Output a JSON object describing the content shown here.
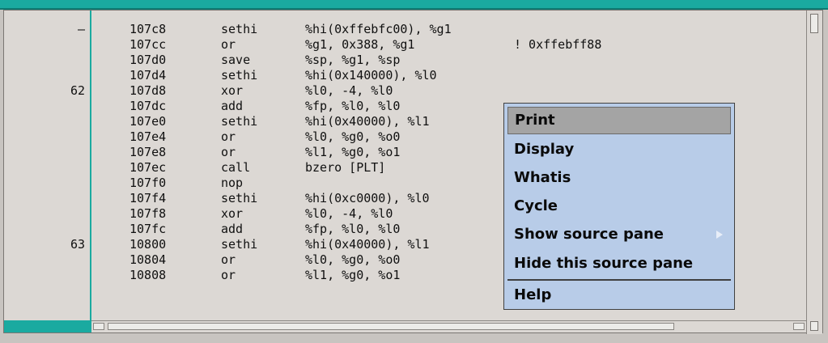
{
  "gutter": {
    "lines": [
      {
        "row": 0,
        "text": "–"
      },
      {
        "row": 4,
        "text": "62"
      },
      {
        "row": 14,
        "text": "63"
      }
    ]
  },
  "code": [
    {
      "addr": "107c8",
      "op": "sethi",
      "args": "%hi(0xffebfc00), %g1",
      "comment": ""
    },
    {
      "addr": "107cc",
      "op": "or",
      "args": "%g1, 0x388, %g1",
      "comment": "! 0xffebff88"
    },
    {
      "addr": "107d0",
      "op": "save",
      "args": "%sp, %g1, %sp",
      "comment": ""
    },
    {
      "addr": "107d4",
      "op": "sethi",
      "args": "%hi(0x140000), %l0",
      "comment": ""
    },
    {
      "addr": "107d8",
      "op": "xor",
      "args": "%l0, -4, %l0",
      "comment": ""
    },
    {
      "addr": "107dc",
      "op": "add",
      "args": "%fp, %l0, %l0",
      "comment": ""
    },
    {
      "addr": "107e0",
      "op": "sethi",
      "args": "%hi(0x40000), %l1",
      "comment": ""
    },
    {
      "addr": "107e4",
      "op": "or",
      "args": "%l0, %g0, %o0",
      "comment": ""
    },
    {
      "addr": "107e8",
      "op": "or",
      "args": "%l1, %g0, %o1",
      "comment": ""
    },
    {
      "addr": "107ec",
      "op": "call",
      "args": "bzero [PLT]",
      "comment": ""
    },
    {
      "addr": "107f0",
      "op": "nop",
      "args": "",
      "comment": ""
    },
    {
      "addr": "107f4",
      "op": "sethi",
      "args": "%hi(0xc0000), %l0",
      "comment": ""
    },
    {
      "addr": "107f8",
      "op": "xor",
      "args": "%l0, -4, %l0",
      "comment": ""
    },
    {
      "addr": "107fc",
      "op": "add",
      "args": "%fp, %l0, %l0",
      "comment": ""
    },
    {
      "addr": "10800",
      "op": "sethi",
      "args": "%hi(0x40000), %l1",
      "comment": ""
    },
    {
      "addr": "10804",
      "op": "or",
      "args": "%l0, %g0, %o0",
      "comment": ""
    },
    {
      "addr": "10808",
      "op": "or",
      "args": "%l1, %g0, %o1",
      "comment": ""
    }
  ],
  "menu": {
    "items": [
      {
        "label": "Print",
        "highlighted": true,
        "submenu": false
      },
      {
        "label": "Display",
        "highlighted": false,
        "submenu": false
      },
      {
        "label": "Whatis",
        "highlighted": false,
        "submenu": false
      },
      {
        "label": "Cycle",
        "highlighted": false,
        "submenu": false
      },
      {
        "label": "Show source pane",
        "highlighted": false,
        "submenu": true
      },
      {
        "label": "Hide this source pane",
        "highlighted": false,
        "submenu": false
      },
      {
        "label": "Help",
        "highlighted": false,
        "submenu": false
      }
    ]
  },
  "colors": {
    "accent": "#1aaaa0",
    "menu_bg": "#b8cce8",
    "menu_highlight": "#a4a4a4"
  }
}
